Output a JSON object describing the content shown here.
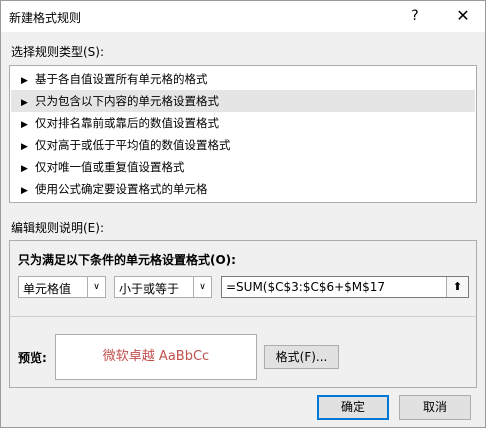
{
  "window": {
    "title": "新建格式规则",
    "help_label": "?",
    "close_label": "✕"
  },
  "rule_type": {
    "label": "选择规则类型(S):",
    "items": [
      {
        "label": "基于各自值设置所有单元格的格式",
        "selected": false
      },
      {
        "label": "只为包含以下内容的单元格设置格式",
        "selected": true
      },
      {
        "label": "仅对排名靠前或靠后的数值设置格式",
        "selected": false
      },
      {
        "label": "仅对高于或低于平均值的数值设置格式",
        "selected": false
      },
      {
        "label": "仅对唯一值或重复值设置格式",
        "selected": false
      },
      {
        "label": "使用公式确定要设置格式的单元格",
        "selected": false
      }
    ],
    "arrow": "▶"
  },
  "edit": {
    "label": "编辑规则说明(E):",
    "condition_title": "只为满足以下条件的单元格设置格式(O):",
    "field_select": "单元格值",
    "operator_select": "小于或等于",
    "formula": "=SUM($C$3:$C$6+$M$17",
    "dropdown_glyph": "∨",
    "collapse_glyph": "⬆",
    "preview_label": "预览:",
    "preview_text": "微软卓越  AaBbCc",
    "format_button": "格式(F)..."
  },
  "buttons": {
    "ok": "确定",
    "cancel": "取消"
  }
}
